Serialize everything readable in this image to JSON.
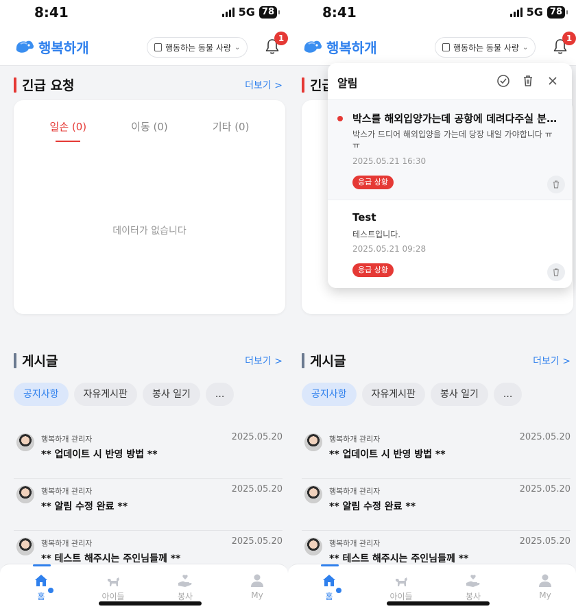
{
  "status": {
    "time": "8:41",
    "network": "5G",
    "battery": "78"
  },
  "app": {
    "logo_text": "행복하개",
    "org_select": "행동하는 동물 사랑",
    "notification_count": "1"
  },
  "emergency": {
    "title": "긴급 요청",
    "more": "더보기 >",
    "tabs": [
      "일손 (0)",
      "이동 (0)",
      "기타 (0)"
    ],
    "empty_text": "데이터가 없습니다"
  },
  "posts": {
    "title": "게시글",
    "more": "더보기 >",
    "chips": [
      "공지사항",
      "자유게시판",
      "봉사 일기",
      "..."
    ],
    "items": [
      {
        "author": "행복하개 관리자",
        "title": "** 업데이트 시 반영 방법 **",
        "date": "2025.05.20"
      },
      {
        "author": "행복하개 관리자",
        "title": "** 알림 수정 완료 **",
        "date": "2025.05.20"
      },
      {
        "author": "행복하개 관리자",
        "title": "** 테스트 해주시는 주인님들께 **",
        "date": "2025.05.20"
      }
    ]
  },
  "nav": {
    "items": [
      "홈",
      "아이들",
      "봉사",
      "My"
    ]
  },
  "notifications": {
    "title": "알림",
    "items": [
      {
        "title": "박스를 해외입양가는데 공항에 데려다주실 분이 계신가요",
        "body": "박스가 드디어 해외입양을 가는데 당장 내일 가야합니다 ㅠㅠ",
        "time": "2025.05.21 16:30",
        "tag": "응급 상황"
      },
      {
        "title": "Test",
        "body": "테스트입니다.",
        "time": "2025.05.21 09:28",
        "tag": "응급 상황"
      }
    ]
  }
}
